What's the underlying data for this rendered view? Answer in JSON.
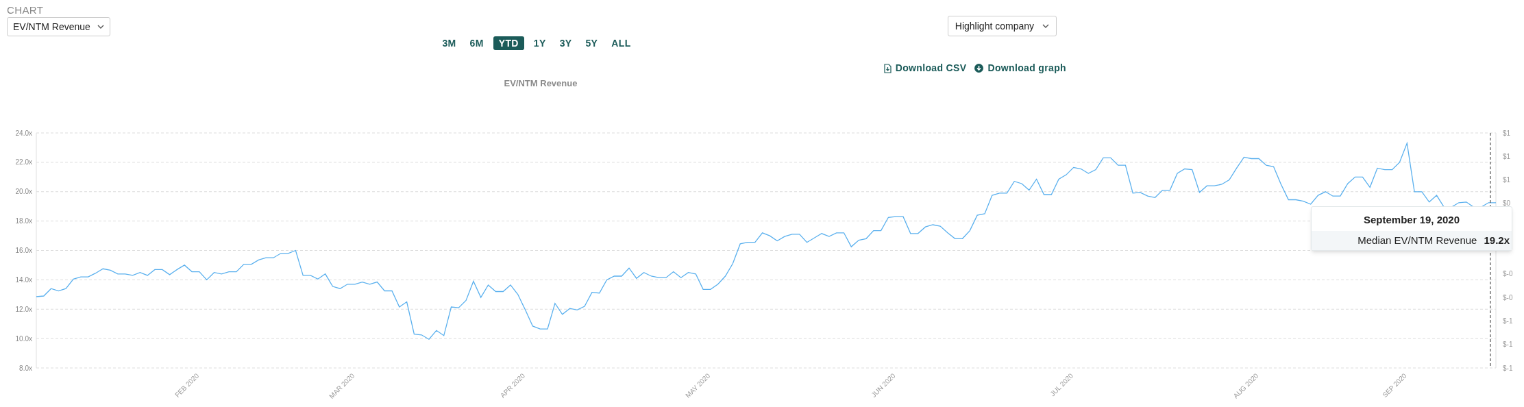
{
  "section_label": "CHART",
  "metric_dropdown": {
    "value": "EV/NTM Revenue"
  },
  "ranges": [
    {
      "label": "3M",
      "selected": false
    },
    {
      "label": "6M",
      "selected": false
    },
    {
      "label": "YTD",
      "selected": true
    },
    {
      "label": "1Y",
      "selected": false
    },
    {
      "label": "3Y",
      "selected": false
    },
    {
      "label": "5Y",
      "selected": false
    },
    {
      "label": "ALL",
      "selected": false
    }
  ],
  "highlight_dropdown": {
    "value": "Highlight company"
  },
  "downloads": [
    {
      "kind": "csv",
      "label": "Download CSV"
    },
    {
      "kind": "graph",
      "label": "Download graph"
    }
  ],
  "chart_data": {
    "type": "line",
    "title": "EV/NTM Revenue",
    "grid": true,
    "ylim": [
      8,
      24
    ],
    "yticks": [
      {
        "value": 8,
        "label": "8.0x"
      },
      {
        "value": 10,
        "label": "10.0x"
      },
      {
        "value": 12,
        "label": "12.0x"
      },
      {
        "value": 14,
        "label": "14.0x"
      },
      {
        "value": 16,
        "label": "16.0x"
      },
      {
        "value": 18,
        "label": "18.0x"
      },
      {
        "value": 20,
        "label": "20.0x"
      },
      {
        "value": 22,
        "label": "22.0x"
      },
      {
        "value": 24,
        "label": "24.0x"
      }
    ],
    "categories": [
      null,
      null,
      null,
      null,
      null,
      null,
      null,
      null,
      null,
      null,
      null,
      null,
      null,
      null,
      null,
      null,
      null,
      null,
      null,
      null,
      null,
      null,
      "FEB 2020",
      null,
      null,
      null,
      null,
      null,
      null,
      null,
      null,
      null,
      null,
      null,
      null,
      null,
      null,
      null,
      null,
      null,
      null,
      null,
      null,
      "MAR 2020",
      null,
      null,
      null,
      null,
      null,
      null,
      null,
      null,
      null,
      null,
      null,
      null,
      null,
      null,
      null,
      null,
      null,
      null,
      null,
      null,
      null,
      null,
      "APR 2020",
      null,
      null,
      null,
      null,
      null,
      null,
      null,
      null,
      null,
      null,
      null,
      null,
      null,
      null,
      null,
      null,
      null,
      null,
      null,
      null,
      null,
      null,
      null,
      null,
      "MAY 2020",
      null,
      null,
      null,
      null,
      null,
      null,
      null,
      null,
      null,
      null,
      null,
      null,
      null,
      null,
      null,
      null,
      null,
      null,
      null,
      null,
      null,
      null,
      null,
      null,
      "JUN 2020",
      null,
      null,
      null,
      null,
      null,
      null,
      null,
      null,
      null,
      null,
      null,
      null,
      null,
      null,
      null,
      null,
      null,
      null,
      null,
      null,
      null,
      null,
      null,
      "JUL 2020",
      null,
      null,
      null,
      null,
      null,
      null,
      null,
      null,
      null,
      null,
      null,
      null,
      null,
      null,
      null,
      null,
      null,
      null,
      null,
      null,
      null,
      null,
      null,
      null,
      "AUG 2020",
      null,
      null,
      null,
      null,
      null,
      null,
      null,
      null,
      null,
      null,
      null,
      null,
      null,
      null,
      null,
      null,
      null,
      null,
      null,
      "SEP 2020",
      null,
      null,
      null,
      null,
      null,
      null,
      null,
      null,
      null,
      null,
      null,
      null
    ],
    "series": [
      {
        "name": "Median EV/NTM Revenue",
        "color": "#5ab0ee",
        "values": [
          12.85,
          12.9,
          13.4,
          13.25,
          13.4,
          14.05,
          14.2,
          14.2,
          14.45,
          14.75,
          14.65,
          14.4,
          14.4,
          14.3,
          14.5,
          14.3,
          14.7,
          14.7,
          14.35,
          14.7,
          15.0,
          14.55,
          14.55,
          14.0,
          14.5,
          14.4,
          14.55,
          14.55,
          15.05,
          15.05,
          15.35,
          15.5,
          15.5,
          15.8,
          15.8,
          16.0,
          14.3,
          14.3,
          14.05,
          14.4,
          13.55,
          13.4,
          13.7,
          13.7,
          13.85,
          13.7,
          13.85,
          13.25,
          13.25,
          12.15,
          12.5,
          10.3,
          10.25,
          9.95,
          10.55,
          10.2,
          12.15,
          12.1,
          12.6,
          13.9,
          12.8,
          13.65,
          13.2,
          13.2,
          13.65,
          13.0,
          11.95,
          10.85,
          10.65,
          10.65,
          12.4,
          11.65,
          12.05,
          11.95,
          12.2,
          13.15,
          13.1,
          14.0,
          14.25,
          14.25,
          14.8,
          14.1,
          14.5,
          14.25,
          14.15,
          14.15,
          14.55,
          14.15,
          14.5,
          14.4,
          13.35,
          13.35,
          13.7,
          14.25,
          15.1,
          16.45,
          16.55,
          16.55,
          17.2,
          17.0,
          16.65,
          16.95,
          17.1,
          17.1,
          16.55,
          16.85,
          17.15,
          16.95,
          17.2,
          17.2,
          16.25,
          16.7,
          16.8,
          17.35,
          17.35,
          18.25,
          18.3,
          18.3,
          17.15,
          17.15,
          17.6,
          17.75,
          17.65,
          17.2,
          16.8,
          16.8,
          17.35,
          18.4,
          18.5,
          19.75,
          19.9,
          19.9,
          20.7,
          20.55,
          20.1,
          20.85,
          19.8,
          19.8,
          20.85,
          21.15,
          21.65,
          21.55,
          21.25,
          21.5,
          22.3,
          22.3,
          21.8,
          21.8,
          19.9,
          19.95,
          19.7,
          19.6,
          20.1,
          20.1,
          21.25,
          21.55,
          21.5,
          19.95,
          20.4,
          20.4,
          20.5,
          20.8,
          21.6,
          22.35,
          22.25,
          22.25,
          21.8,
          21.7,
          20.5,
          19.45,
          19.45,
          19.35,
          19.15,
          19.75,
          20.0,
          19.7,
          19.7,
          20.55,
          21.0,
          21.0,
          20.3,
          21.6,
          21.5,
          21.5,
          22.0,
          23.3,
          20.0,
          20.0,
          19.3,
          19.75,
          18.95,
          18.95,
          19.25,
          19.3,
          18.95,
          18.95,
          19.25,
          19.25
        ]
      }
    ]
  },
  "secondary_axis": {
    "upper": [
      "$1",
      "$1",
      "$1",
      "$0"
    ],
    "lower": [
      "$-0",
      "$-0",
      "$-1",
      "$-1",
      "$-1"
    ]
  },
  "tooltip": {
    "date": "September 19, 2020",
    "value": "19.2x"
  }
}
